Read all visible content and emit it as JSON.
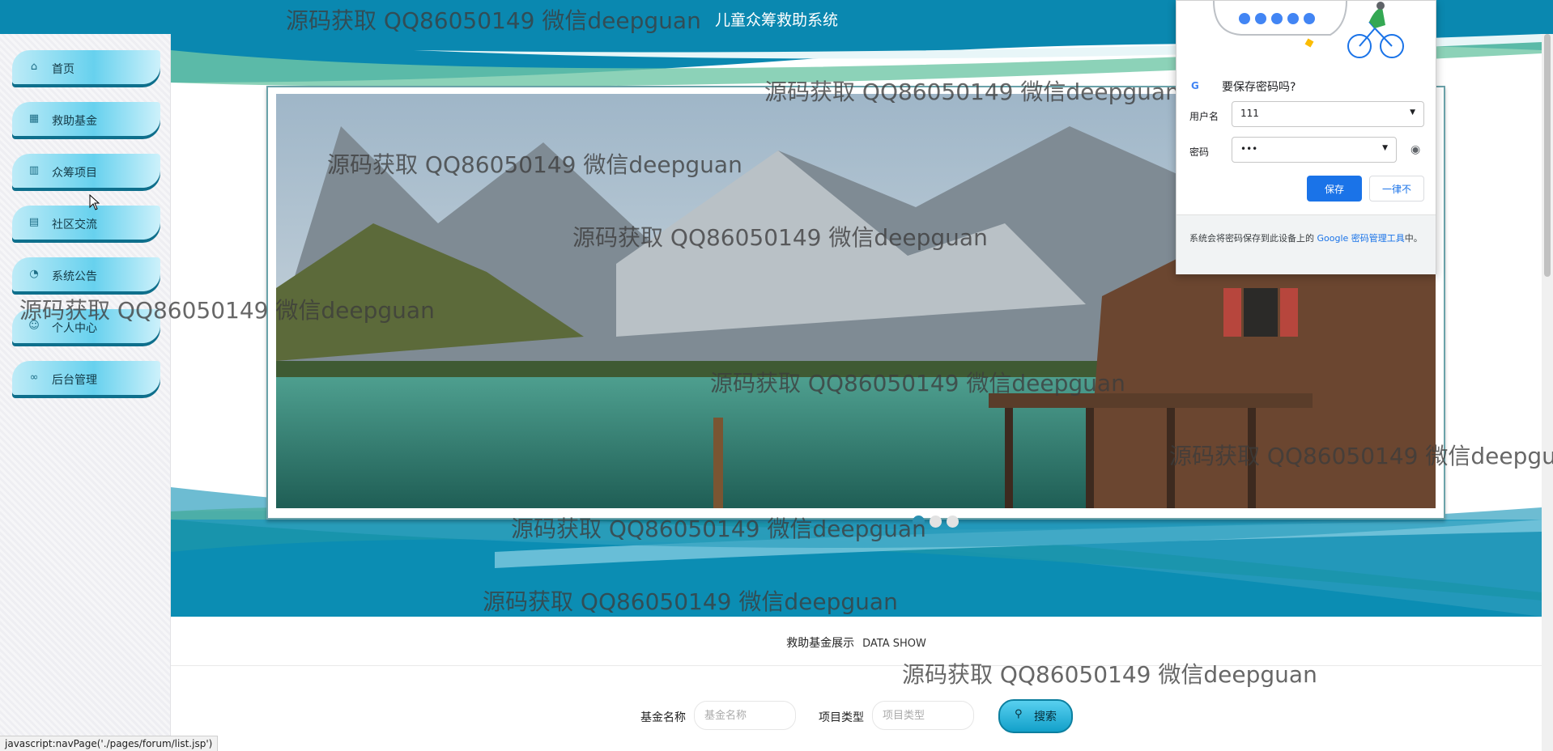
{
  "header": {
    "title": "儿童众筹救助系统"
  },
  "sidebar": {
    "items": [
      {
        "label": "首页",
        "icon": "home-icon"
      },
      {
        "label": "救助基金",
        "icon": "grid-icon"
      },
      {
        "label": "众筹项目",
        "icon": "building-icon"
      },
      {
        "label": "社区交流",
        "icon": "calendar-icon"
      },
      {
        "label": "系统公告",
        "icon": "gauge-icon"
      },
      {
        "label": "个人中心",
        "icon": "user-icon"
      },
      {
        "label": "后台管理",
        "icon": "link-icon"
      }
    ]
  },
  "carousel": {
    "slides": 3,
    "active_index": 0
  },
  "section": {
    "title": "救助基金展示",
    "subtitle": "DATA SHOW"
  },
  "search": {
    "fund_name_label": "基金名称",
    "fund_name_placeholder": "基金名称",
    "project_type_label": "项目类型",
    "project_type_placeholder": "项目类型",
    "button_label": "搜索"
  },
  "status_bar": {
    "url": "javascript:navPage('./pages/forum/list.jsp')"
  },
  "watermark": {
    "text": "源码获取 QQ86050149 微信deepguan"
  },
  "password_popup": {
    "title": "要保存密码吗?",
    "username_label": "用户名",
    "username_value": "111",
    "password_label": "密码",
    "password_value": "•••",
    "save_label": "保存",
    "never_label": "一律不",
    "footer_text": "系统会将密码保存到此设备上的",
    "footer_link": "Google 密码管理工具",
    "footer_suffix": "中。"
  },
  "colors": {
    "header": "#0a88b0",
    "accent": "#12a0ca",
    "google_blue": "#1a73e8"
  }
}
